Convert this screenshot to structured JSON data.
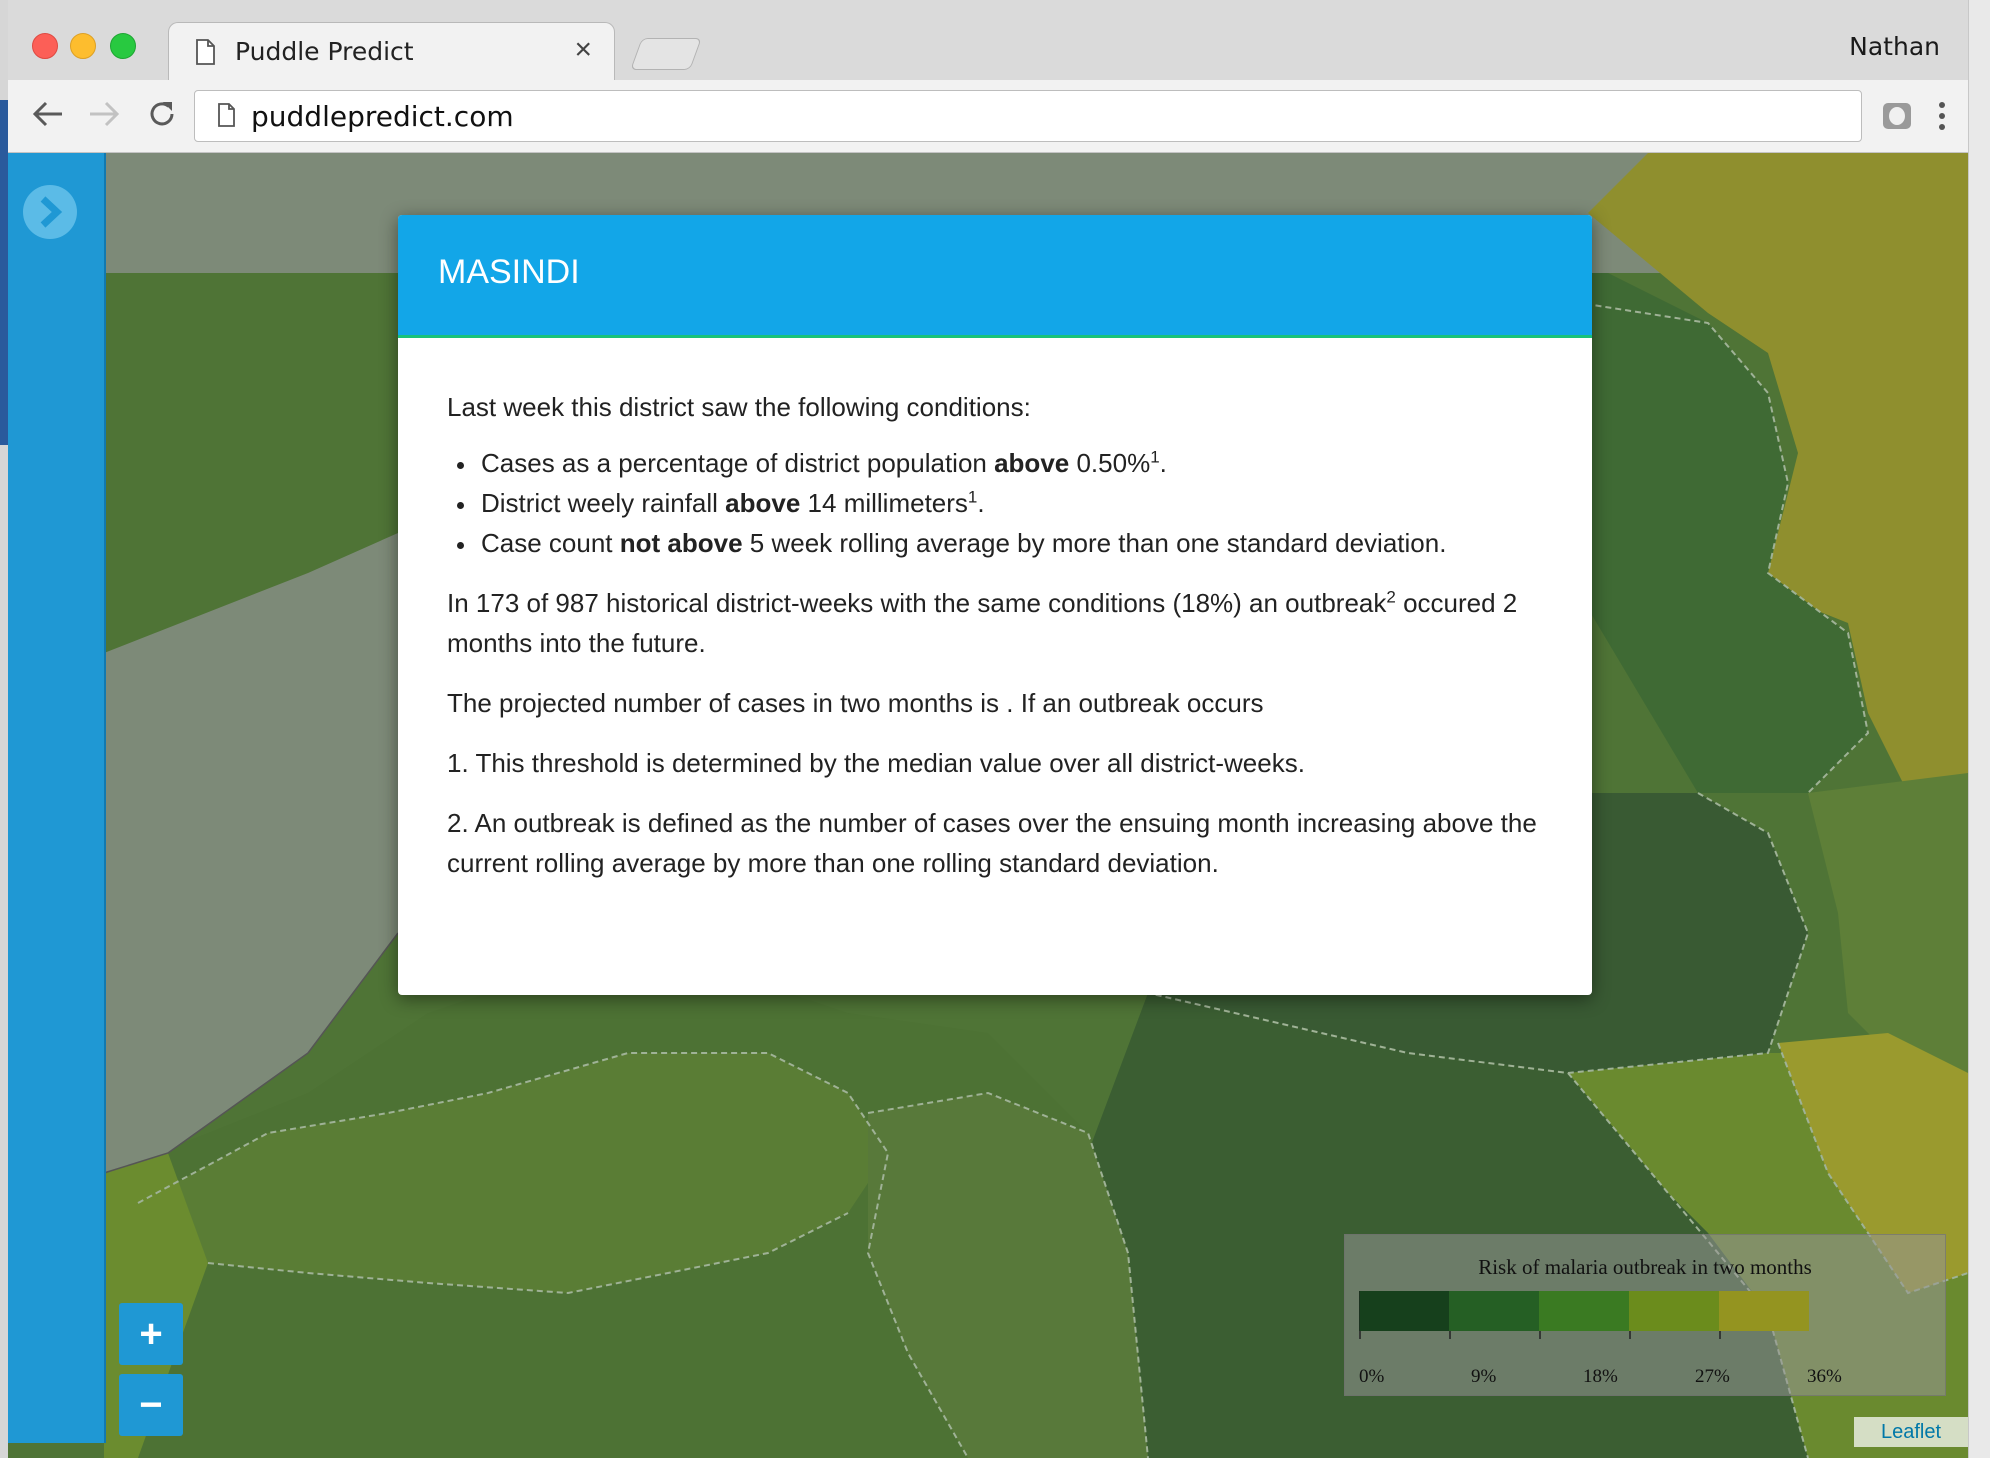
{
  "browser": {
    "tab_title": "Puddle Predict",
    "tab_close": "×",
    "profile_name": "Nathan",
    "url": "puddlepredict.com"
  },
  "map": {
    "zoom_in_label": "+",
    "zoom_out_label": "−",
    "attribution": "Leaflet",
    "legend": {
      "title": "Risk of malaria outbreak in two months",
      "colors": [
        "#16401c",
        "#255f24",
        "#3a7a22",
        "#6b8c1c",
        "#949420"
      ],
      "ticks": [
        "0%",
        "9%",
        "18%",
        "27%",
        "36%"
      ]
    }
  },
  "modal": {
    "title": "MASINDI",
    "intro": "Last week this district saw the following conditions:",
    "cond1": {
      "pre": "Cases as a percentage of district population ",
      "bold": "above",
      "post": " 0.50%",
      "sup": "1",
      "end": "."
    },
    "cond2": {
      "pre": "District weely rainfall ",
      "bold": "above",
      "post": " 14 millimeters",
      "sup": "1",
      "end": "."
    },
    "cond3": {
      "pre": "Case count ",
      "bold": "not above",
      "post": " 5 week rolling average by more than one standard deviation."
    },
    "history": {
      "pre": "In 173 of 987 historical district-weeks with the same conditions (18%) an outbreak",
      "sup": "2",
      "post": " occured 2 months into the future."
    },
    "projection": "The projected number of cases in two months is . If an outbreak occurs",
    "note1": "1. This threshold is determined by the median value over all district-weeks.",
    "note2": "2. An outbreak is defined as the number of cases over the ensuing month increasing above the current rolling average by more than one rolling standard deviation."
  }
}
